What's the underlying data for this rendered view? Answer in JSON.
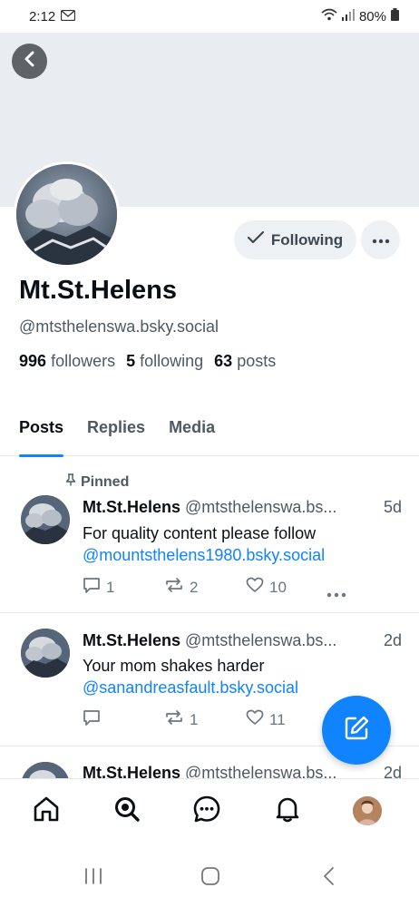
{
  "status": {
    "time": "2:12",
    "battery": "80%"
  },
  "profile": {
    "display_name": "Mt.St.Helens",
    "handle": "@mtsthelenswa.bsky.social",
    "followers_count": "996",
    "followers_label": "followers",
    "following_count": "5",
    "following_label": "following",
    "posts_count": "63",
    "posts_label": "posts",
    "follow_button": "Following"
  },
  "tabs": [
    {
      "label": "Posts",
      "active": true
    },
    {
      "label": "Replies",
      "active": false
    },
    {
      "label": "Media",
      "active": false
    }
  ],
  "posts": [
    {
      "pinned_label": "Pinned",
      "author": "Mt.St.Helens",
      "handle": "@mtsthelenswa.bs...",
      "time": "5d",
      "text": "For quality content please follow",
      "link": "@mountsthelens1980.bsky.social",
      "replies": "1",
      "reposts": "2",
      "likes": "10"
    },
    {
      "author": "Mt.St.Helens",
      "handle": "@mtsthelenswa.bs...",
      "time": "2d",
      "text": "Your mom shakes harder",
      "link": "@sanandreasfault.bsky.social",
      "replies": "",
      "reposts": "1",
      "likes": "11"
    },
    {
      "author": "Mt.St.Helens",
      "handle": "@mtsthelenswa.bs...",
      "time": "2d"
    }
  ],
  "icons": {
    "back": "chevron-left-icon",
    "follow_check": "check-icon",
    "more": "ellipsis-icon",
    "compose": "compose-icon",
    "nav": [
      "home-icon",
      "search-icon",
      "chat-icon",
      "bell-icon",
      "avatar"
    ]
  },
  "colors": {
    "accent": "#1083fe",
    "banner": "#e9ecf0",
    "muted": "#4e5964"
  }
}
